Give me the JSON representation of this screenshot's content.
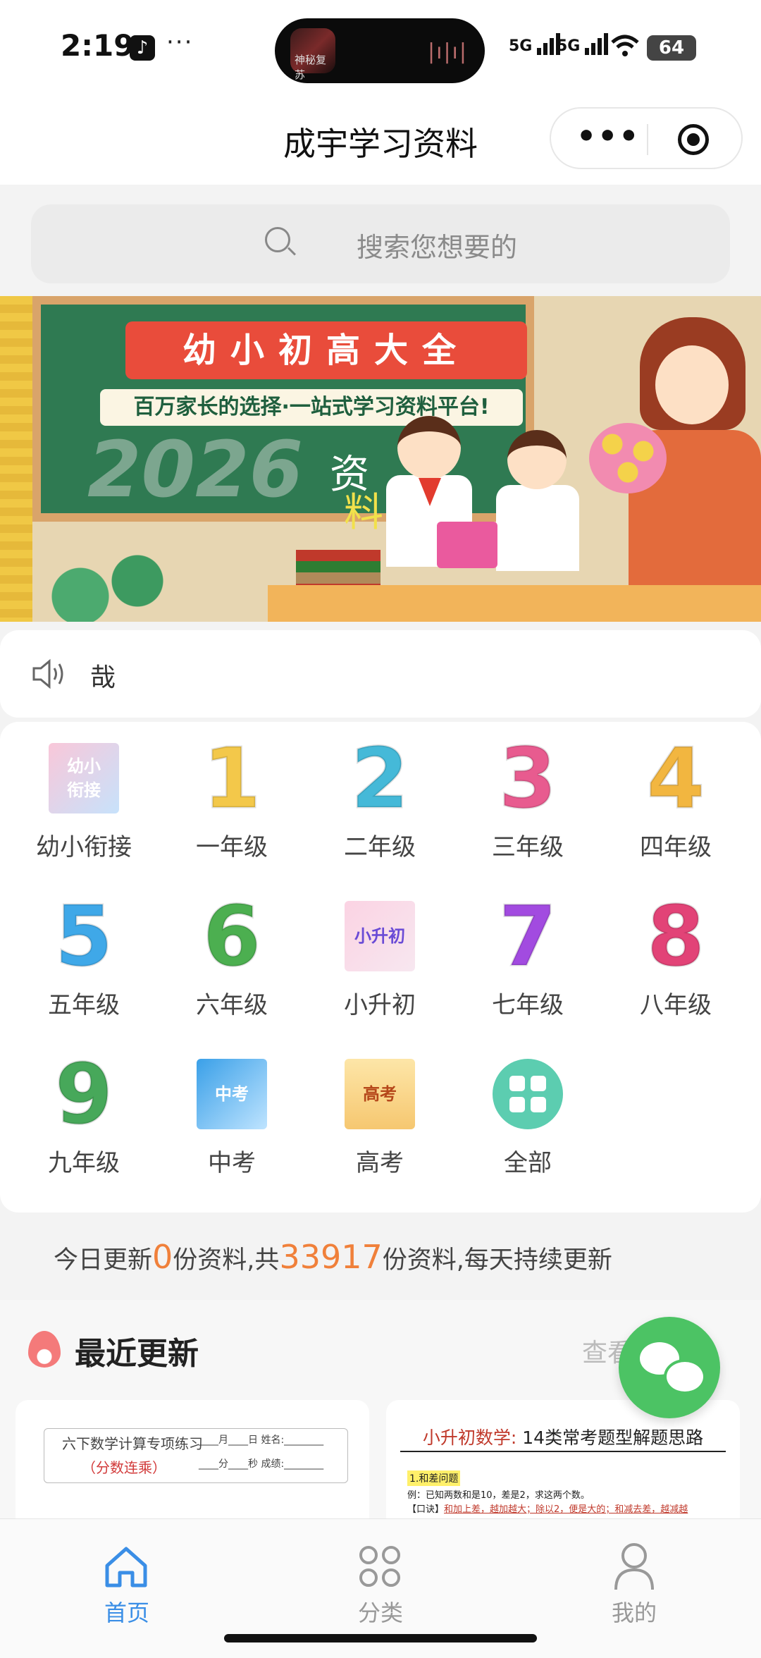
{
  "status_bar": {
    "time": "2:19",
    "app_icon": "tiktok-icon",
    "more": "···",
    "island_caption": "神秘复苏",
    "signal1": "5G",
    "signal2": "5G",
    "battery": "64"
  },
  "nav": {
    "title": "成宇学习资料",
    "more": "•••"
  },
  "search": {
    "placeholder": "搜索您想要的"
  },
  "banner": {
    "ribbon": "幼小初高大全",
    "slogan": "百万家长的选择·一站式学习资料平台!",
    "year": "2026",
    "word1": "资",
    "word2": "料"
  },
  "notice": {
    "text": "哉"
  },
  "grades": [
    {
      "label": "幼小衔接",
      "icon": "kindergarten-bridge-icon",
      "badge": "幼小\n衔接"
    },
    {
      "label": "一年级",
      "icon": "number-1-icon",
      "num": "1",
      "color": "#f3c84a"
    },
    {
      "label": "二年级",
      "icon": "number-2-icon",
      "num": "2",
      "color": "#45b9d8"
    },
    {
      "label": "三年级",
      "icon": "number-3-icon",
      "num": "3",
      "color": "#e85b8f"
    },
    {
      "label": "四年级",
      "icon": "number-4-icon",
      "num": "4",
      "color": "#f2b640"
    },
    {
      "label": "五年级",
      "icon": "number-5-icon",
      "num": "5",
      "color": "#3fa8e8"
    },
    {
      "label": "六年级",
      "icon": "number-6-icon",
      "num": "6",
      "color": "#4caf50"
    },
    {
      "label": "小升初",
      "icon": "primary-to-middle-icon",
      "badge": "小升初"
    },
    {
      "label": "七年级",
      "icon": "number-7-icon",
      "num": "7",
      "color": "#a24be0"
    },
    {
      "label": "八年级",
      "icon": "number-8-icon",
      "num": "8",
      "color": "#e24377"
    },
    {
      "label": "九年级",
      "icon": "number-9-icon",
      "num": "9",
      "color": "#47a85a"
    },
    {
      "label": "中考",
      "icon": "zhongkao-icon",
      "badge": "中考"
    },
    {
      "label": "高考",
      "icon": "gaokao-icon",
      "badge": "高考"
    },
    {
      "label": "全部",
      "icon": "all-grid-icon"
    }
  ],
  "stats": {
    "prefix": "今日更新",
    "today": "0",
    "middle": "份资料,共",
    "total": "33917",
    "suffix": "份资料,每天持续更新"
  },
  "recent": {
    "title": "最近更新",
    "view_more": "查看",
    "card1": {
      "title": "六下数学计算专项练习",
      "subtitle": "（分数连乘）",
      "row1": "____月____日   姓名:________",
      "row2": "____分____秒   成绩:________"
    },
    "card2": {
      "title_red": "小升初数学:",
      "title_black": " 14类常考题型解题思路",
      "tag": "1.和差问题",
      "example": "例：已知两数和是10，差是2，求这两个数。",
      "rhyme_prefix": "【口诀】",
      "rhyme": "和加上差，越加越大；除以2，便是大的；和减去差，越减越"
    }
  },
  "tabbar": {
    "home": "首页",
    "category": "分类",
    "mine": "我的"
  },
  "colors": {
    "accent": "#3a8ee6",
    "highlight": "#f0803a",
    "wechat": "#4cc364"
  }
}
